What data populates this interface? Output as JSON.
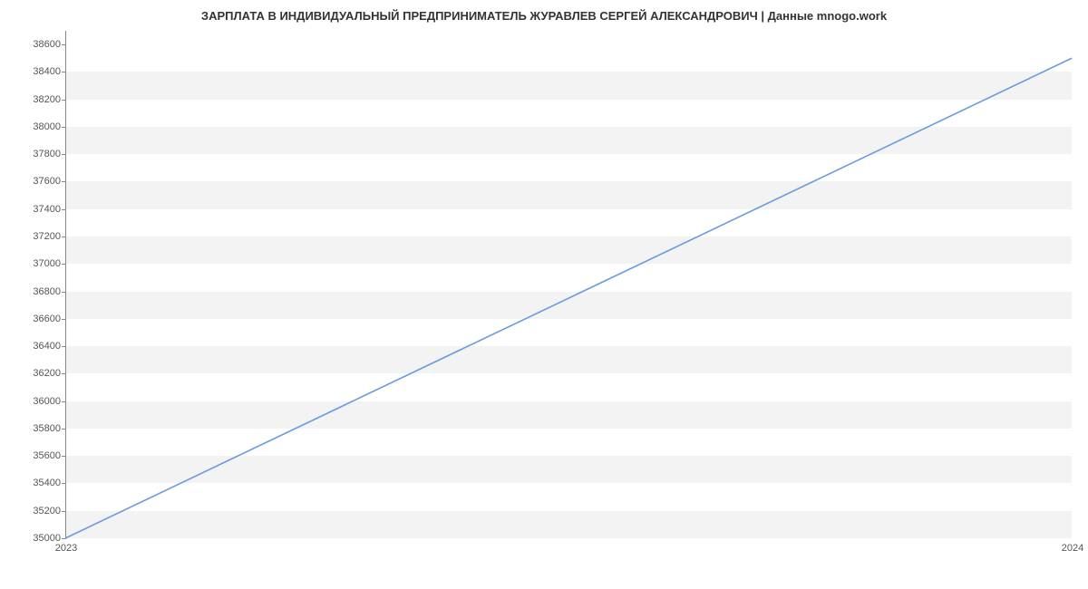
{
  "chart_data": {
    "type": "line",
    "title": "ЗАРПЛАТА В ИНДИВИДУАЛЬНЫЙ ПРЕДПРИНИМАТЕЛЬ ЖУРАВЛЕВ СЕРГЕЙ АЛЕКСАНДРОВИЧ | Данные mnogo.work",
    "x": [
      2023,
      2024
    ],
    "values": [
      35000,
      38500
    ],
    "xlabel": "",
    "ylabel": "",
    "x_ticks": [
      2023,
      2024
    ],
    "y_ticks": [
      35000,
      35200,
      35400,
      35600,
      35800,
      36000,
      36200,
      36400,
      36600,
      36800,
      37000,
      37200,
      37400,
      37600,
      37800,
      38000,
      38200,
      38400,
      38600
    ],
    "ylim": [
      35000,
      38700
    ],
    "xlim": [
      2023,
      2024
    ],
    "colors": {
      "line": "#6a9ae0",
      "band": "#f3f3f4"
    }
  }
}
